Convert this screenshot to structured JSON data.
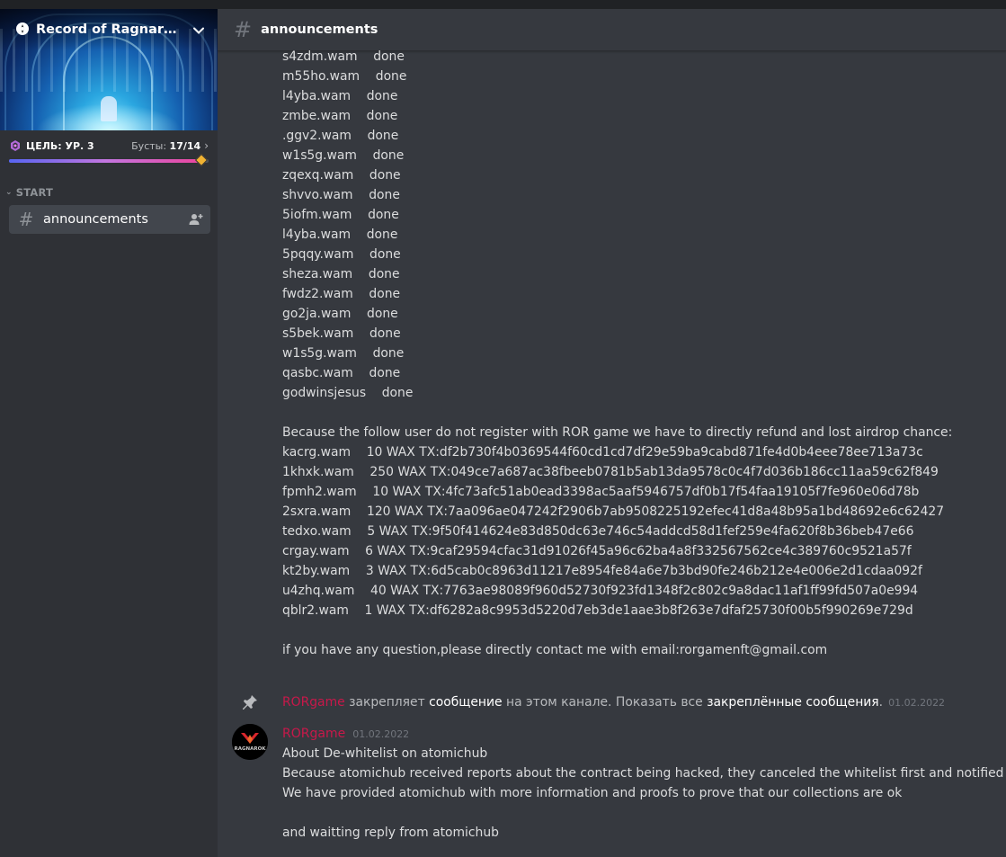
{
  "server": {
    "name": "Record of Ragnarok ...",
    "goal_label": "ЦЕЛЬ: УР. 3",
    "boosts_label": "Бусты:",
    "boosts_count": "17/14",
    "boost_progress": 0.97
  },
  "sidebar": {
    "category": "START",
    "channels": [
      {
        "name": "announcements"
      }
    ]
  },
  "channel": {
    "title": "announcements"
  },
  "message_lines": [
    "s4zdm.wam    done",
    "m55ho.wam    done",
    "l4yba.wam    done",
    "zmbe.wam    done",
    ".ggv2.wam    done",
    "w1s5g.wam    done",
    "zqexq.wam    done",
    "shvvo.wam    done",
    "5iofm.wam    done",
    "l4yba.wam    done",
    "5pqqy.wam    done",
    "sheza.wam    done",
    "fwdz2.wam    done",
    "go2ja.wam    done",
    "s5bek.wam    done",
    "w1s5g.wam    done",
    "qasbc.wam    done",
    "godwinsjesus    done",
    "",
    "Because the follow user do not register with ROR game we have to directly refund and lost airdrop chance:",
    "kacrg.wam    10 WAX TX:df2b730f4b0369544f60cd1cd7df29e59ba9cabd871fe4d0b4eee78ee713a73c",
    "1khxk.wam    250 WAX TX:049ce7a687ac38fbeeb0781b5ab13da9578c0c4f7d036b186cc11aa59c62f849",
    "fpmh2.wam    10 WAX TX:4fc73afc51ab0ead3398ac5aaf5946757df0b17f54faa19105f7fe960e06d78b",
    "2sxra.wam    120 WAX TX:7aa096ae047242f2906b7ab9508225192efec41d8a48b95a1bd48692e6c62427",
    "tedxo.wam    5 WAX TX:9f50f414624e83d850dc63e746c54addcd58d1fef259e4fa620f8b36beb47e66",
    "crgay.wam    6 WAX TX:9caf29594cfac31d91026f45a96c62ba4a8f332567562ce4c389760c9521a57f",
    "kt2by.wam    3 WAX TX:6d5cab0c8963d11217e8954fe84a6e7b3bd90fe246b212e4e006e2d1cdaa092f",
    "u4zhq.wam    40 WAX TX:7763ae98089f960d52730f923fd1348f2c802c9a8dac11af1ff99fd507a0e994",
    "qblr2.wam    1 WAX TX:df6282a8c9953d5220d7eb3de1aae3b8f263e7dfaf25730f00b5f990269e729d",
    "",
    "if you have any question,please directly contact me with email:rorgamenft@gmail.com"
  ],
  "pin_notice": {
    "user": "RORgame",
    "text1": " закрепляет ",
    "link1": "сообщение",
    "text2": " на этом канале. Показать все ",
    "link2": "закреплённые сообщения",
    "text3": ".",
    "timestamp": "01.02.2022"
  },
  "message": {
    "author": "RORgame",
    "timestamp": "01.02.2022",
    "avatar_text": "RAGNAROK",
    "lines": [
      "About De-whitelist on atomichub",
      "Because atomichub received reports about the contract being hacked, they canceled the whitelist first and notified us.",
      "We have provided atomichub with more information and proofs to prove that our collections are ok",
      "",
      "and waitting reply from atomichub"
    ]
  },
  "colors": {
    "author": "#c8184a",
    "sidebar": "#2f3136",
    "main": "#36393f"
  }
}
